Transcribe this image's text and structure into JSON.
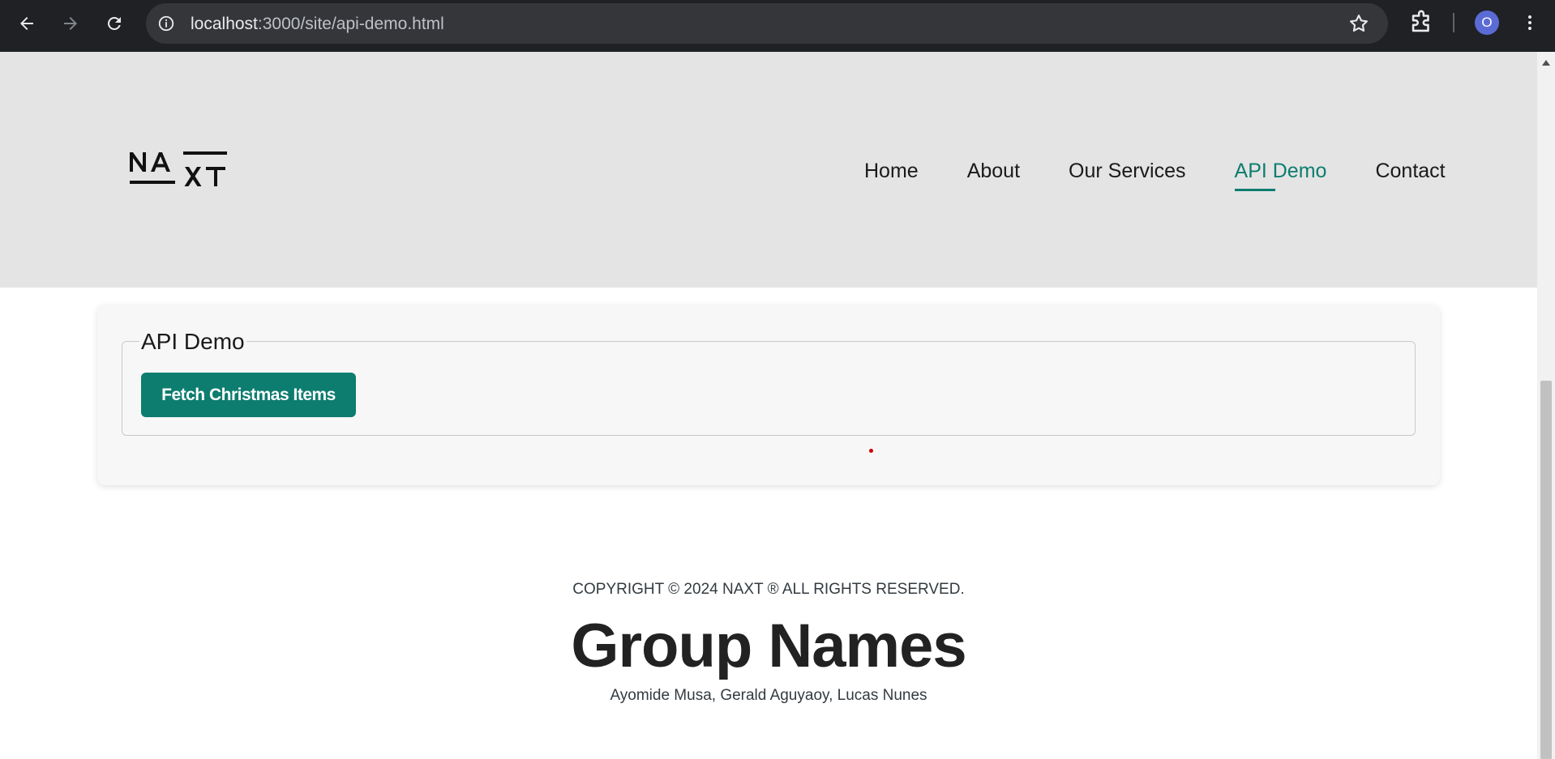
{
  "browser": {
    "url_host": "localhost",
    "url_path": ":3000/site/api-demo.html",
    "profile_initial": "O",
    "icons": [
      "back-arrow-icon",
      "forward-arrow-icon",
      "reload-icon",
      "site-info-icon",
      "bookmark-star-icon",
      "extensions-icon",
      "more-menu-icon"
    ]
  },
  "header": {
    "logo_text": "NAXT",
    "nav": [
      "Home",
      "About",
      "Our Services",
      "API Demo",
      "Contact"
    ],
    "active_nav": "API Demo"
  },
  "demo": {
    "legend": "API Demo",
    "fetch_button": "Fetch Christmas Items"
  },
  "footer": {
    "copyright": "COPYRIGHT © 2024 NAXT ® ALL RIGHTS RESERVED.",
    "group_title": "Group Names",
    "members": "Ayomide Musa, Gerald Aguyaoy, Lucas Nunes"
  },
  "colors": {
    "accent": "#0d7d6f",
    "header_bg": "#e4e4e4",
    "chrome_bg": "#202124"
  }
}
